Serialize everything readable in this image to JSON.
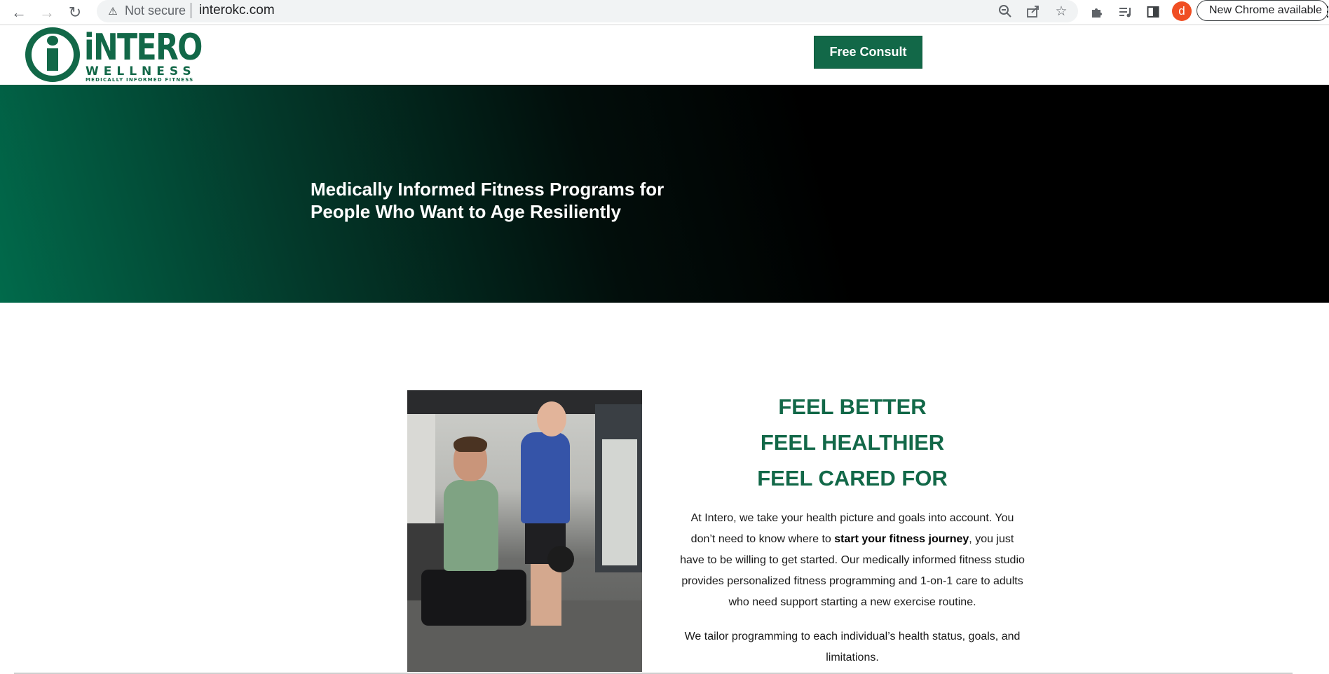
{
  "browser": {
    "back_icon": "←",
    "forward_icon": "→",
    "reload_icon": "↻",
    "security_label": "Not secure",
    "url": "interokc.com",
    "update_label": "New Chrome available",
    "profile_initial": "d",
    "icons": [
      "zoom-icon",
      "share-icon",
      "bookmark-star-icon",
      "extensions-icon",
      "reading-list-icon",
      "side-panel-icon"
    ]
  },
  "header": {
    "logo_word": "iNTERO",
    "logo_sub": "WELLNESS",
    "logo_tag": "MEDICALLY INFORMED FITNESS",
    "cta_label": "Free Consult"
  },
  "hero": {
    "title": "Medically Informed Fitness Programs for People Who Want to Age Resiliently"
  },
  "intro": {
    "feel_lines": [
      "FEEL BETTER",
      "FEEL HEALTHIER",
      "FEEL CARED FOR"
    ],
    "p1_before": "At Intero, we take your health picture and goals into account. You don’t need to know where to ",
    "p1_bold": "start your fitness journey",
    "p1_after": ", you just have to be willing to get started. Our medically informed fitness studio provides personalized fitness programming and 1-on-1 care to adults who need support starting a new exercise routine.",
    "p2": "We tailor programming to each individual’s health status, goals, and limitations."
  },
  "colors": {
    "brand_green": "#126848",
    "hero_gradient_start": "#016a4b",
    "hero_gradient_end": "#000000"
  }
}
